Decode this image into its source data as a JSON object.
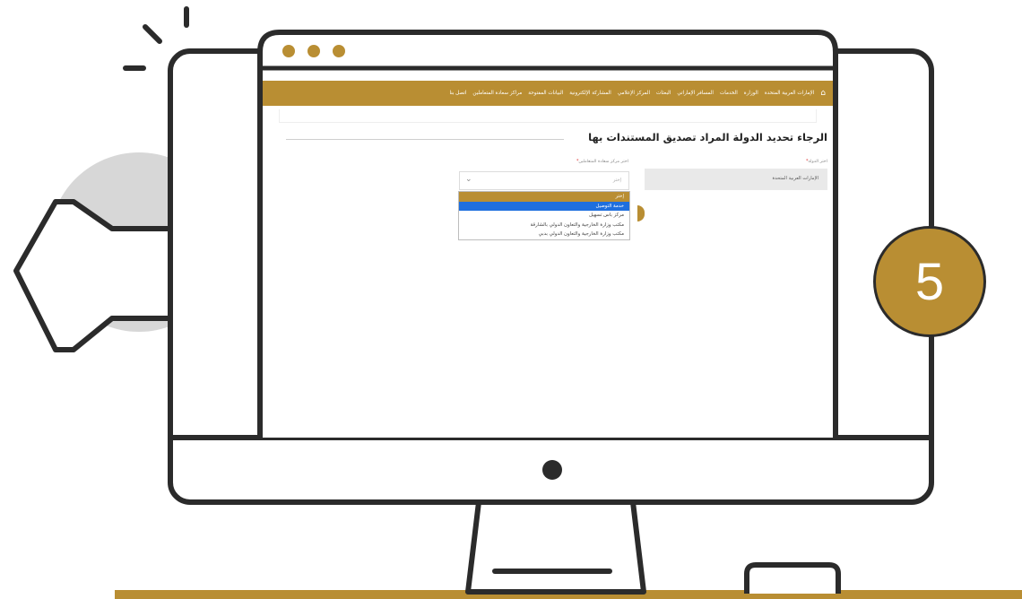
{
  "colors": {
    "gold": "#b98e33",
    "outline": "#2b2b2b",
    "selected": "#1f6fde",
    "back_circle": "#d7d7d7"
  },
  "browser": {
    "dots": [
      "dot",
      "dot",
      "dot"
    ]
  },
  "nav": {
    "home_icon": "home-icon",
    "items": [
      "الإمارات العربية المتحدة",
      "الوزارة",
      "الخدمات",
      "المسافر الإماراتي",
      "البعثات",
      "المركز الإعلامي",
      "المشاركة الإلكترونية",
      "البيانات المفتوحة",
      "مراكز سعادة المتعاملين",
      "اتصل بنا"
    ]
  },
  "page": {
    "title": "الرجاء تحديد الدولة المراد تصديق المستندات بها",
    "country_label": "اختر الدولة",
    "center_label": "اختر مركز سعادة المتعاملين",
    "required_mark": "*",
    "country_value": "الإمارات العربية المتحدة",
    "center_placeholder": "إختر"
  },
  "dropdown": {
    "options": [
      "إختر",
      "خدمة التوصيل",
      "مركز باس تسهيل",
      "مكتب وزارة الخارجية والتعاون الدولي بالشارقة",
      "مكتب وزارة الخارجية والتعاون الدولي بدبي"
    ],
    "highlighted_index": 0,
    "selected_index": 1
  },
  "step": {
    "number": "5"
  }
}
